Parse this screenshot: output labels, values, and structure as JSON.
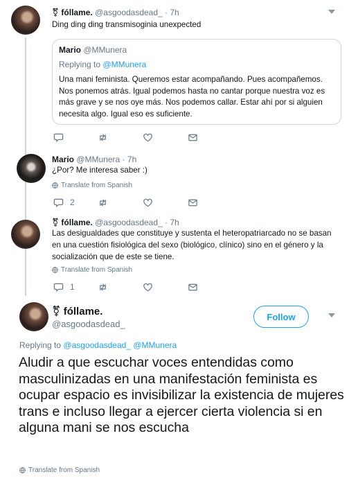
{
  "tweet1": {
    "symbol": "⚧",
    "name": "fóllame.",
    "handle": "@asgoodasdead_",
    "time": "· 7h",
    "text": "Ding ding ding transmisoginia unexpected",
    "quote": {
      "name": "Mario",
      "handle": "@MMunera",
      "replying_prefix": "Replying to",
      "replying_link": "@MMunera",
      "text": "Una mani feminista. Queremos estar acompañando. Pues acompañemos. Nos ponemos atrás. Igual podemos hasta no cantar porque nuestra voz es más grave y se nos oye más. Nos podemos callar. Estar ahí por si alguien necesita algo. Igual eso es suficiente."
    }
  },
  "tweet2": {
    "name": "Mario",
    "handle": "@MMunera",
    "time": "· 7h",
    "text": "¿Por? Me interesa saber :)",
    "translate": "Translate from Spanish",
    "reply_count": "2"
  },
  "tweet3": {
    "symbol": "⚧",
    "name": "fóllame.",
    "handle": "@asgoodasdead_",
    "time": "· 7h",
    "text": "Las desigualdades que constituye y sustenta el heteropatriarcado no se basan en una cuestión fisiológica del sexo (biológico, clínico) sino en el género y la socialización que de este se tiene.",
    "translate": "Translate from Spanish",
    "reply_count": "1"
  },
  "main": {
    "name": "⚧ fóllame.",
    "handle": "@asgoodasdead_",
    "follow_label": "Follow",
    "replying_prefix": "Replying to",
    "replying_links": "@asgoodasdead_ @MMunera",
    "text": "Aludir a que escuchar voces entendidas como masculinizadas en una manifestación feminista es ocupar espacio es invisibilizar la existencia de mujeres trans e incluso llegar a ejercer cierta violencia si en alguna mani se nos escucha",
    "translate": "Translate from Spanish"
  },
  "colors": {
    "accent": "#1da1f2",
    "secondary_text": "#657786",
    "thread_line": "#ccd6dd"
  },
  "icons": [
    "reply-icon",
    "retweet-icon",
    "like-icon",
    "message-icon",
    "globe-icon",
    "caret-down-icon"
  ]
}
